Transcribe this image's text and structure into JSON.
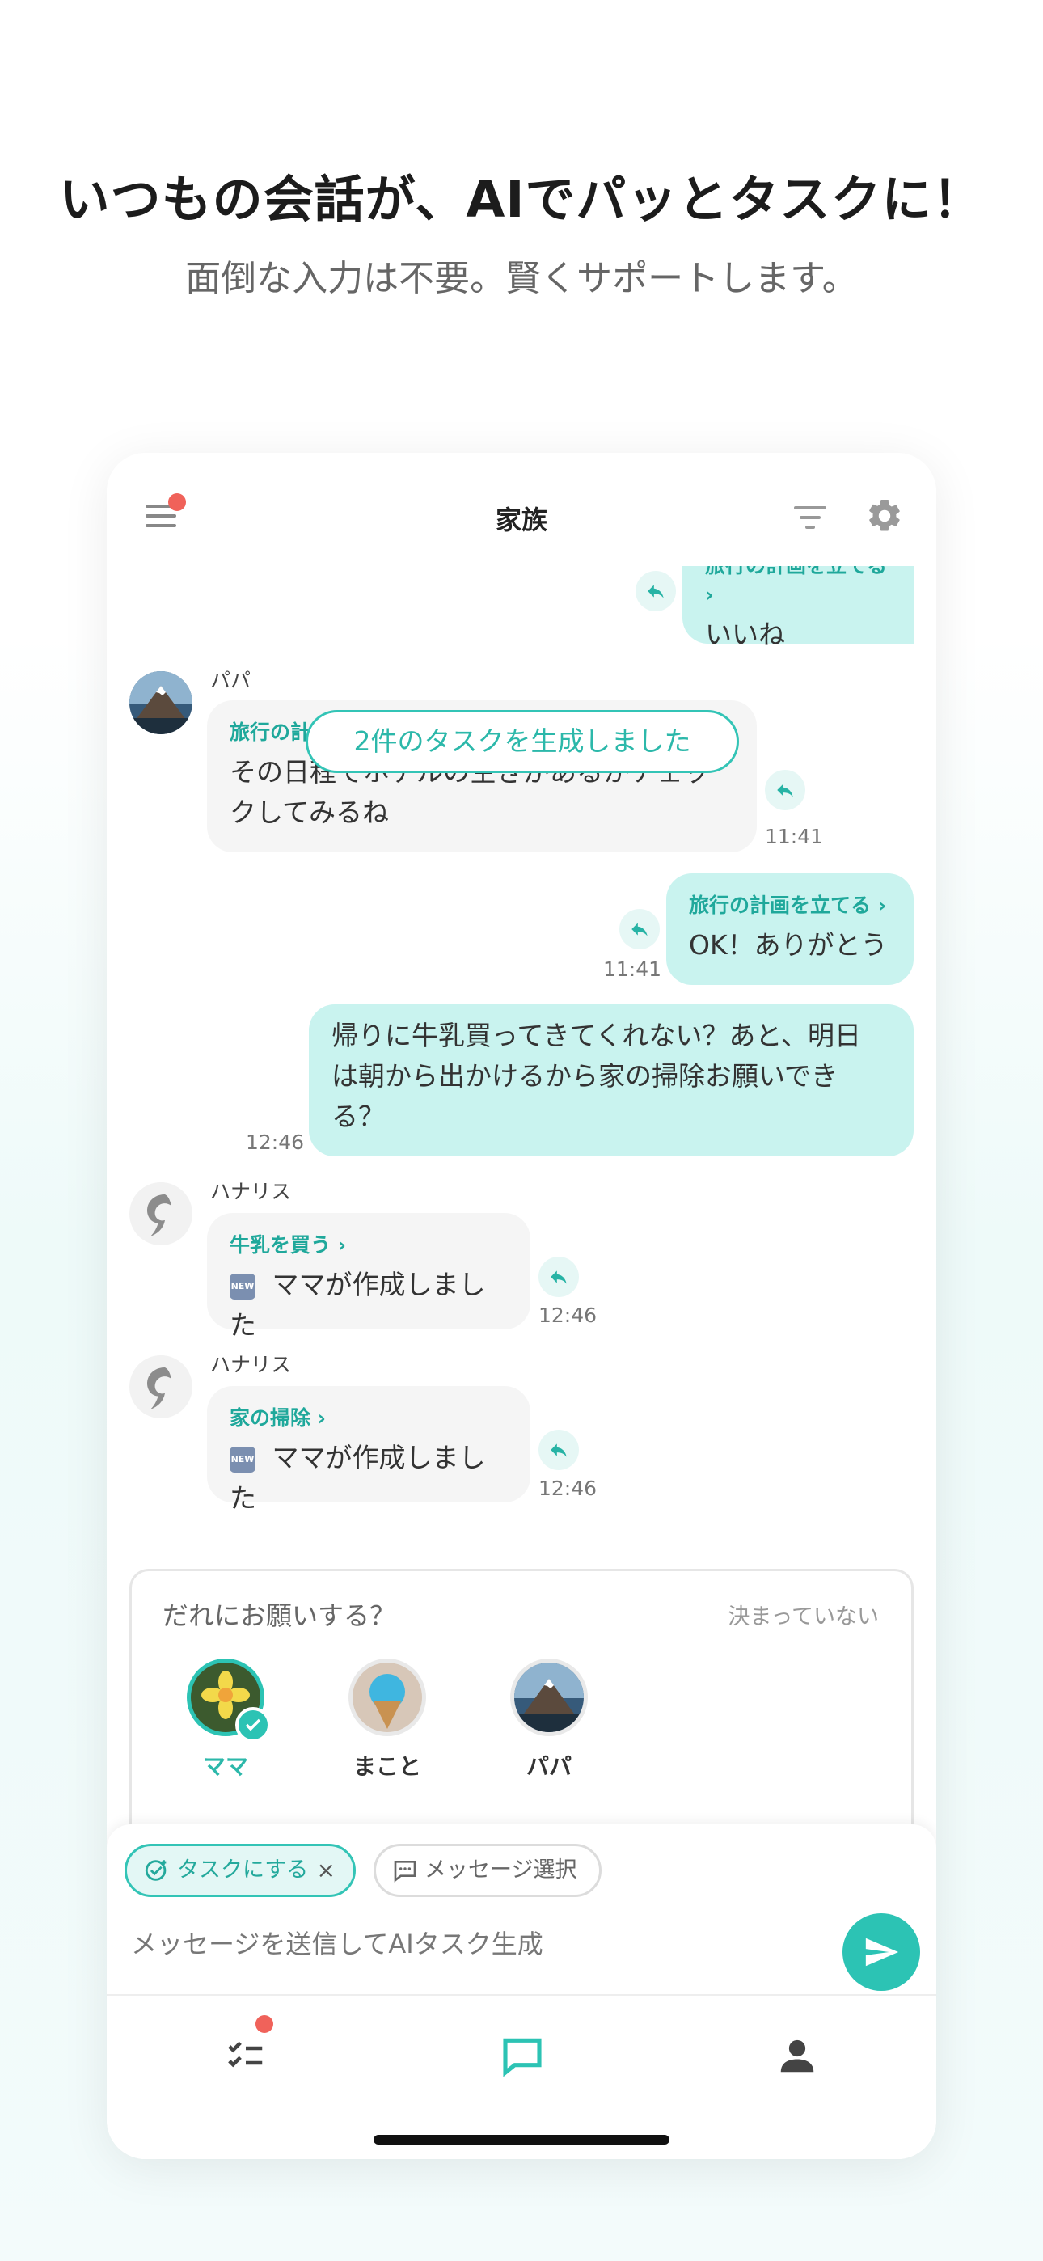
{
  "promo": {
    "headline": "いつもの会話が、AIでパッとタスクに！",
    "subline": "面倒な入力は不要。賢くサポートします。"
  },
  "header": {
    "title": "家族",
    "icons": [
      "menu-icon",
      "filter-icon",
      "gear-icon"
    ],
    "menu_has_badge": true
  },
  "chat": {
    "generated_banner": "2件のタスクを生成しました",
    "messages": [
      {
        "side": "out",
        "task": "旅行の計画を立てる ›",
        "text": "いいね",
        "partially_hidden": true
      },
      {
        "side": "in",
        "sender": "パパ",
        "task": "旅行の計画を立てる ›",
        "text": "その日程でホテルの空きがあるかチェッ",
        "text2": "クしてみるね",
        "time": "11:41"
      },
      {
        "side": "out",
        "task": "旅行の計画を立てる ›",
        "text": "OK！ありがとう",
        "time": "11:41"
      },
      {
        "side": "out",
        "text": "帰りに牛乳買ってきてくれない？あと、明日",
        "text2": "は朝から出かけるから家の掃除お願いでき",
        "text3": "る？",
        "time": "12:46"
      },
      {
        "side": "in",
        "sender": "ハナリス",
        "task": "牛乳を買う ›",
        "badge": "NEW",
        "text": "ママが作成しました",
        "time": "12:46"
      },
      {
        "side": "in",
        "sender": "ハナリス",
        "task": "家の掃除 ›",
        "badge": "NEW",
        "text": "ママが作成しました",
        "time": "12:46"
      }
    ]
  },
  "assign": {
    "question": "だれにお願いする？",
    "none_label": "決まっていない",
    "assignees": [
      {
        "name": "ママ",
        "selected": true
      },
      {
        "name": "まこと",
        "selected": false
      },
      {
        "name": "パパ",
        "selected": false
      }
    ]
  },
  "composer": {
    "task_chip": "タスクにする",
    "task_chip_close": "×",
    "select_chip": "メッセージ選択",
    "placeholder": "メッセージを送信してAIタスク生成"
  },
  "tabbar": {
    "tabs": [
      "tasks-icon",
      "chat-icon",
      "profile-icon"
    ],
    "active": "chat-icon",
    "tasks_has_badge": true
  },
  "colors": {
    "accent": "#2cc3b4",
    "bubble_out": "#c9f3ef",
    "bubble_in": "#f5f5f5",
    "badge_red": "#f0625a"
  }
}
